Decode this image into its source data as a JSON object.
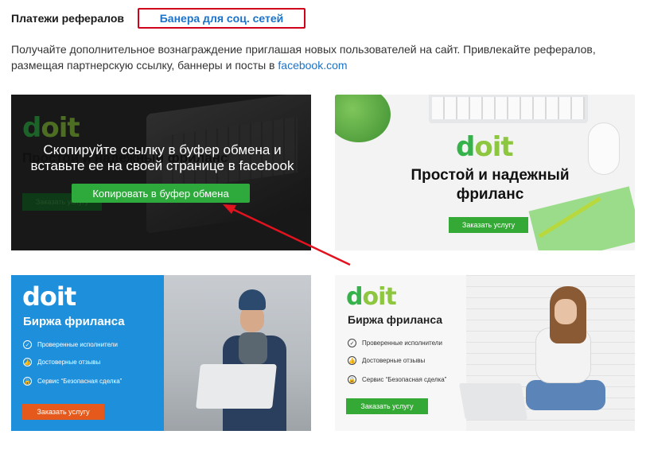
{
  "tabs": {
    "payments": "Платежи рефералов",
    "banners": "Банера для соц. сетей"
  },
  "intro": {
    "text": "Получайте дополнительное вознаграждение приглашая новых пользователей на сайт. Привлекайте рефералов, размещая партнерскую ссылку, баннеры и посты в ",
    "link": "facebook.com"
  },
  "logo": {
    "d": "d",
    "oit": "oit"
  },
  "banner1": {
    "under_title": "Простой и надежный фриланс",
    "under_button": "Заказать услугу",
    "overlay_text": "Скопируйте ссылку в буфер обмена и вставьте ее на своей странице в facebook",
    "copy_button": "Копировать в буфер обмена"
  },
  "banner2": {
    "title": "Простой и надежный фриланс",
    "button": "Заказать услугу"
  },
  "banner3": {
    "title": "Биржа фриланса",
    "features": [
      "Проверенные исполнители",
      "Достоверные отзывы",
      "Сервис “Безопасная сделка”"
    ],
    "button": "Заказать услугу"
  },
  "banner4": {
    "title": "Биржа фриланса",
    "features": [
      "Проверенные исполнители",
      "Достоверные отзывы",
      "Сервис “Безопасная сделка”"
    ],
    "button": "Заказать услугу"
  },
  "colors": {
    "link": "#1a73c9",
    "highlight": "#d0021b",
    "green": "#35a935",
    "orange": "#e55a1c",
    "blue_banner": "#1e8fdb"
  }
}
